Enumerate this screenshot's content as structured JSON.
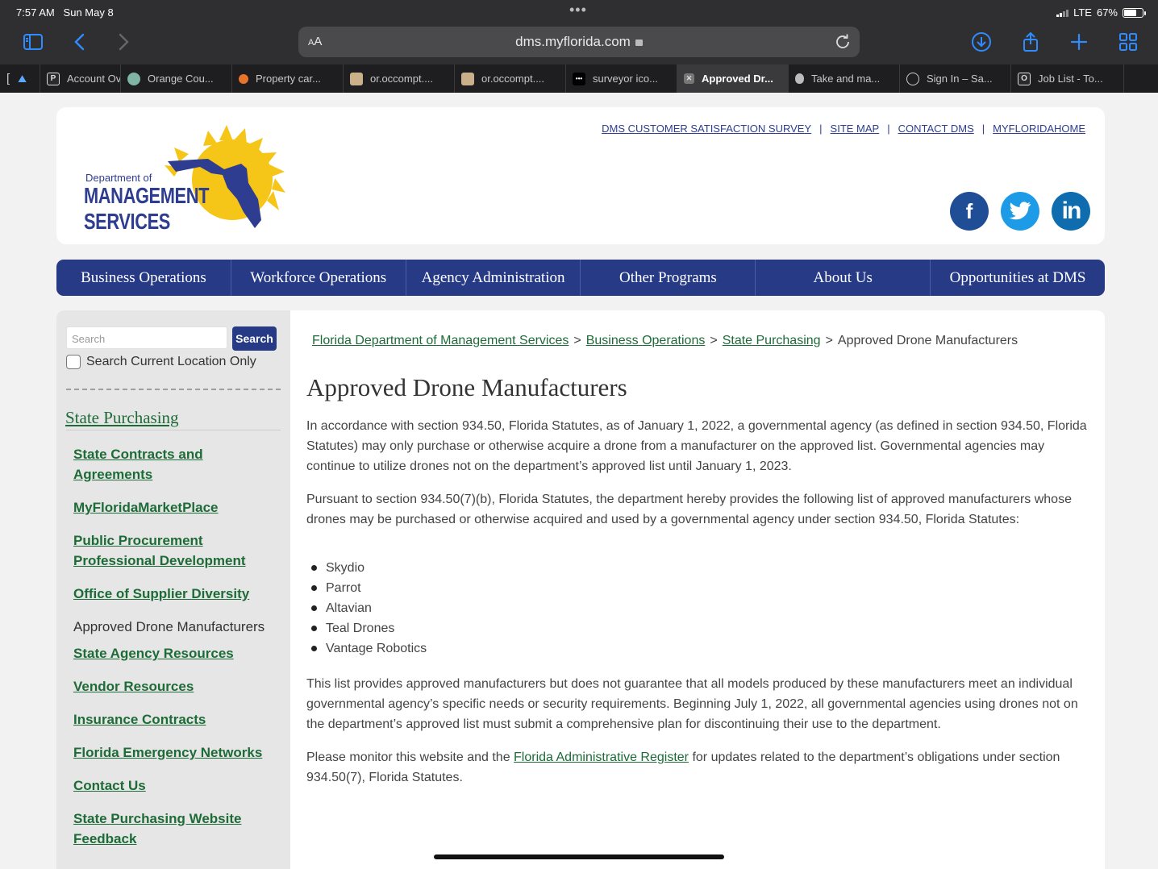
{
  "status": {
    "time": "7:57 AM",
    "date": "Sun May 8",
    "network": "LTE",
    "battery": "67%",
    "battery_level": 0.67
  },
  "browser": {
    "font_size_label_small": "A",
    "font_size_label_large": "A",
    "url": "dms.myflorida.com",
    "tabs": [
      {
        "label": "Account Ov",
        "icon": "p-box-icon",
        "iconText": "P"
      },
      {
        "label": "Orange Cou...",
        "icon": "seal-icon",
        "iconText": ""
      },
      {
        "label": "Property car...",
        "icon": "fox-icon",
        "iconText": ""
      },
      {
        "label": "or.occompt....",
        "icon": "doc-thumb-icon",
        "iconText": ""
      },
      {
        "label": "or.occompt....",
        "icon": "doc-thumb-icon",
        "iconText": ""
      },
      {
        "label": "surveyor ico...",
        "icon": "dots-icon",
        "iconText": "•••"
      },
      {
        "label": "Approved Dr...",
        "icon": "close-tab-icon",
        "iconText": "✕"
      },
      {
        "label": "Take and ma...",
        "icon": "apple-icon",
        "iconText": ""
      },
      {
        "label": "Sign In – Sa...",
        "icon": "sailboat-icon",
        "iconText": ""
      },
      {
        "label": "Job List - To...",
        "icon": "o-box-icon",
        "iconText": "O"
      }
    ]
  },
  "header": {
    "links": [
      "DMS CUSTOMER SATISFACTION SURVEY",
      "SITE MAP",
      "CONTACT DMS",
      "MYFLORIDAHOME"
    ],
    "logo": {
      "line1": "Department of",
      "line2": "MANAGEMENT",
      "line3": "SERVICES"
    },
    "social": {
      "facebook": "f",
      "linkedin": "in"
    }
  },
  "nav": [
    "Business Operations",
    "Workforce Operations",
    "Agency Administration",
    "Other Programs",
    "About Us",
    "Opportunities at DMS"
  ],
  "sidebar": {
    "search_placeholder": "Search",
    "search_button": "Search",
    "checkbox_label": "Search Current Location Only",
    "section_title": "State Purchasing",
    "links": [
      {
        "label": "State Contracts and Agreements",
        "current": false
      },
      {
        "label": "MyFloridaMarketPlace",
        "current": false
      },
      {
        "label": "Public Procurement Professional Development",
        "current": false
      },
      {
        "label": "Office of Supplier Diversity",
        "current": false
      },
      {
        "label": "Approved Drone Manufacturers",
        "current": true
      },
      {
        "label": "State Agency Resources",
        "current": false
      },
      {
        "label": "Vendor Resources",
        "current": false
      },
      {
        "label": "Insurance Contracts",
        "current": false
      },
      {
        "label": "Florida Emergency Networks",
        "current": false
      },
      {
        "label": "Contact Us",
        "current": false
      },
      {
        "label": "State Purchasing Website Feedback",
        "current": false
      }
    ]
  },
  "content": {
    "breadcrumb": {
      "links": [
        "Florida Department of Management Services",
        "Business Operations",
        "State Purchasing"
      ],
      "current": "Approved Drone Manufacturers",
      "separator": ">"
    },
    "title": "Approved Drone Manufacturers",
    "para1": "In accordance with section 934.50, Florida Statutes, as of January 1, 2022, a governmental agency (as defined in section 934.50, Florida Statutes) may only purchase or otherwise acquire a drone from a manufacturer on the approved list. Governmental agencies may continue to utilize drones not on the department’s approved list until January 1, 2023.",
    "para2": "Pursuant to section 934.50(7)(b), Florida Statutes, the department hereby provides the following list of approved manufacturers whose drones may be purchased or otherwise acquired and used by a governmental agency under section 934.50, Florida Statutes:",
    "manufacturers": [
      "Skydio",
      "Parrot",
      "Altavian",
      "Teal Drones",
      "Vantage Robotics"
    ],
    "para3": "This list provides approved manufacturers but does not guarantee that all models produced by these manufacturers meet an individual governmental agency’s specific needs or security requirements. Beginning July 1, 2022, all governmental agencies using drones not on the department’s approved list must submit a comprehensive plan for discontinuing their use to the department.",
    "para4_before": "Please monitor this website and the ",
    "para4_link": "Florida Administrative Register",
    "para4_after": " for updates related to the department’s obligations under section 934.50(7), Florida Statutes."
  }
}
